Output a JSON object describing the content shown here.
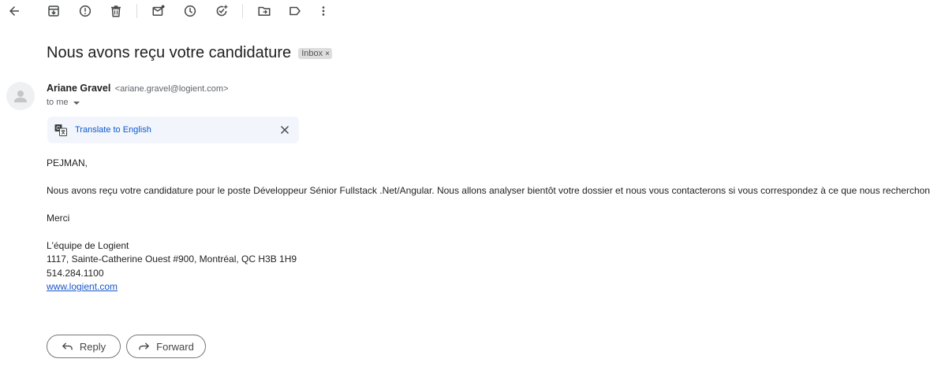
{
  "toolbar": {
    "icons": [
      "back-arrow-icon",
      "archive-icon",
      "report-spam-icon",
      "delete-icon",
      "mark-unread-icon",
      "snooze-icon",
      "add-to-tasks-icon",
      "move-to-icon",
      "label-icon",
      "more-options-icon"
    ]
  },
  "email": {
    "subject": "Nous avons reçu votre candidature",
    "label": "Inbox",
    "label_remove": "×",
    "sender_name": "Ariane Gravel",
    "sender_email": "<ariane.gravel@logient.com>",
    "to": "to me"
  },
  "translate": {
    "link": "Translate to English"
  },
  "body": {
    "greeting": "PEJMAN,",
    "paragraph": "Nous avons reçu votre candidature pour le poste Développeur Sénior Fullstack .Net/Angular. Nous allons analyser bientôt votre dossier et nous vous contacterons si vous correspondez à ce que nous recherchons.",
    "thanks": "Merci",
    "signature": {
      "team": "L'équipe de Logient",
      "address": "1117, Sainte-Catherine Ouest #900, Montréal, QC H3B 1H9",
      "phone": "514.284.1100",
      "website": "www.logient.com"
    }
  },
  "actions": {
    "reply": "Reply",
    "forward": "Forward"
  },
  "colors": {
    "link": "#0b57d0",
    "translate_bg": "#f2f6fc",
    "chip_bg": "#dddddd"
  }
}
